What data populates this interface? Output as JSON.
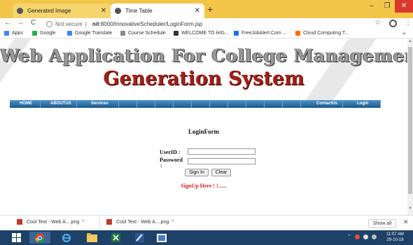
{
  "browser": {
    "tabs": [
      {
        "label": "Generated Image",
        "active": false
      },
      {
        "label": "Time Table",
        "active": true
      }
    ],
    "new_tab_glyph": "+",
    "address": {
      "security": "Not secure",
      "separator": "|",
      "host": "nit",
      "url_rest": ":8000/InnovativeScheduler/LoginForm.jsp"
    },
    "bookmarks": [
      {
        "label": "Apps",
        "color": "#4285f4"
      },
      {
        "label": "Google",
        "color": "#34a853"
      },
      {
        "label": "Google Translate",
        "color": "#4285f4"
      },
      {
        "label": "Course Schedule",
        "color": "#8a8a8a"
      },
      {
        "label": "WELCOME TO HIG...",
        "color": "#333333"
      },
      {
        "label": "FreeJobAlert.Com ...",
        "color": "#1a73e8"
      },
      {
        "label": "Cloud Computing T...",
        "color": "#ff6d00"
      }
    ],
    "bookmarks_more": "»",
    "icons": {
      "back": "←",
      "forward": "→",
      "reload": "C",
      "star": "☆",
      "menu": "⋮",
      "tab_close": "✕",
      "minimize": "–",
      "maximize": "❐",
      "close": "✕"
    }
  },
  "page": {
    "title_line1": "Web Application For College Management  and Time Table",
    "title_line2": "Generation System",
    "nav": {
      "home": "HOME",
      "aboutus": "ABOUTUS",
      "services": "Services",
      "contactus": "ContactUs",
      "login": "Login"
    },
    "form": {
      "title": "LoginForm",
      "userid_label": "UserID :",
      "password_label": "Password",
      "password_colon": ":",
      "userid_value": "",
      "password_value": "",
      "signin_label": "Sign In",
      "clear_label": "Clear",
      "signup_link": "SignUp Here ! !......"
    },
    "colors": {
      "title_gray": "#9a9a9a",
      "subtitle_red": "#a1211a",
      "nav_blue": "#2a6ea6",
      "signup_red": "#d42424"
    }
  },
  "downloads": {
    "items": [
      {
        "label": "Cool Text - Web A....png"
      },
      {
        "label": "Cool Text - Web A....png"
      }
    ],
    "chevron": "^",
    "show_all": "Show all",
    "close": "✕"
  },
  "taskbar": {
    "apps": [
      "start",
      "chrome",
      "internet-explorer",
      "file-explorer",
      "excel",
      "paint",
      "presentation"
    ],
    "clock_time": "11:07 AM",
    "clock_date": "29-10-19"
  }
}
